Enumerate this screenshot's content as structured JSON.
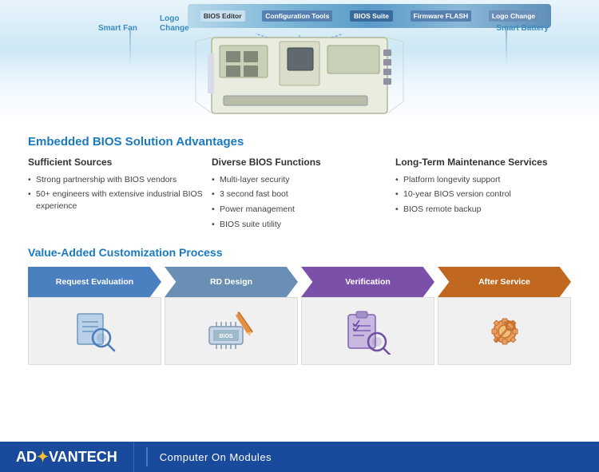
{
  "diagram": {
    "labels": {
      "smart_fan": "Smart Fan",
      "logo_change_left": "Logo\nChange",
      "bios_editor": "BIOS Editor",
      "config_tools": "Configuration Tools",
      "bios_suite": "BIOS Suite",
      "firmware_flash": "Firmware FLASH",
      "logo_change_right": "Logo Change",
      "smart_battery": "Smart Battery"
    }
  },
  "advantages": {
    "section_title": "Embedded BIOS Solution Advantages",
    "columns": [
      {
        "header": "Sufficient Sources",
        "items": [
          "Strong partnership with BIOS vendors",
          "50+ engineers with extensive industrial BIOS experience"
        ]
      },
      {
        "header": "Diverse BIOS Functions",
        "items": [
          "Multi-layer security",
          "3 second fast boot",
          "Power management",
          "BIOS suite utility"
        ]
      },
      {
        "header": "Long-Term Maintenance Services",
        "items": [
          "Platform longevity support",
          "10-year BIOS version control",
          "BIOS remote backup"
        ]
      }
    ]
  },
  "process": {
    "section_title": "Value-Added Customization Process",
    "steps": [
      {
        "label": "Request Evaluation",
        "color": "#4a7fc0",
        "icon": "🔍"
      },
      {
        "label": "RD Design",
        "color": "#6a8fb5",
        "icon": "✏️"
      },
      {
        "label": "Verification",
        "color": "#7a50a8",
        "icon": "📋"
      },
      {
        "label": "After Service",
        "color": "#c06820",
        "icon": "🔧"
      }
    ]
  },
  "footer": {
    "brand": "AD",
    "brand2": "VANTECH",
    "divider": "|",
    "tagline": "Computer On Modules"
  }
}
